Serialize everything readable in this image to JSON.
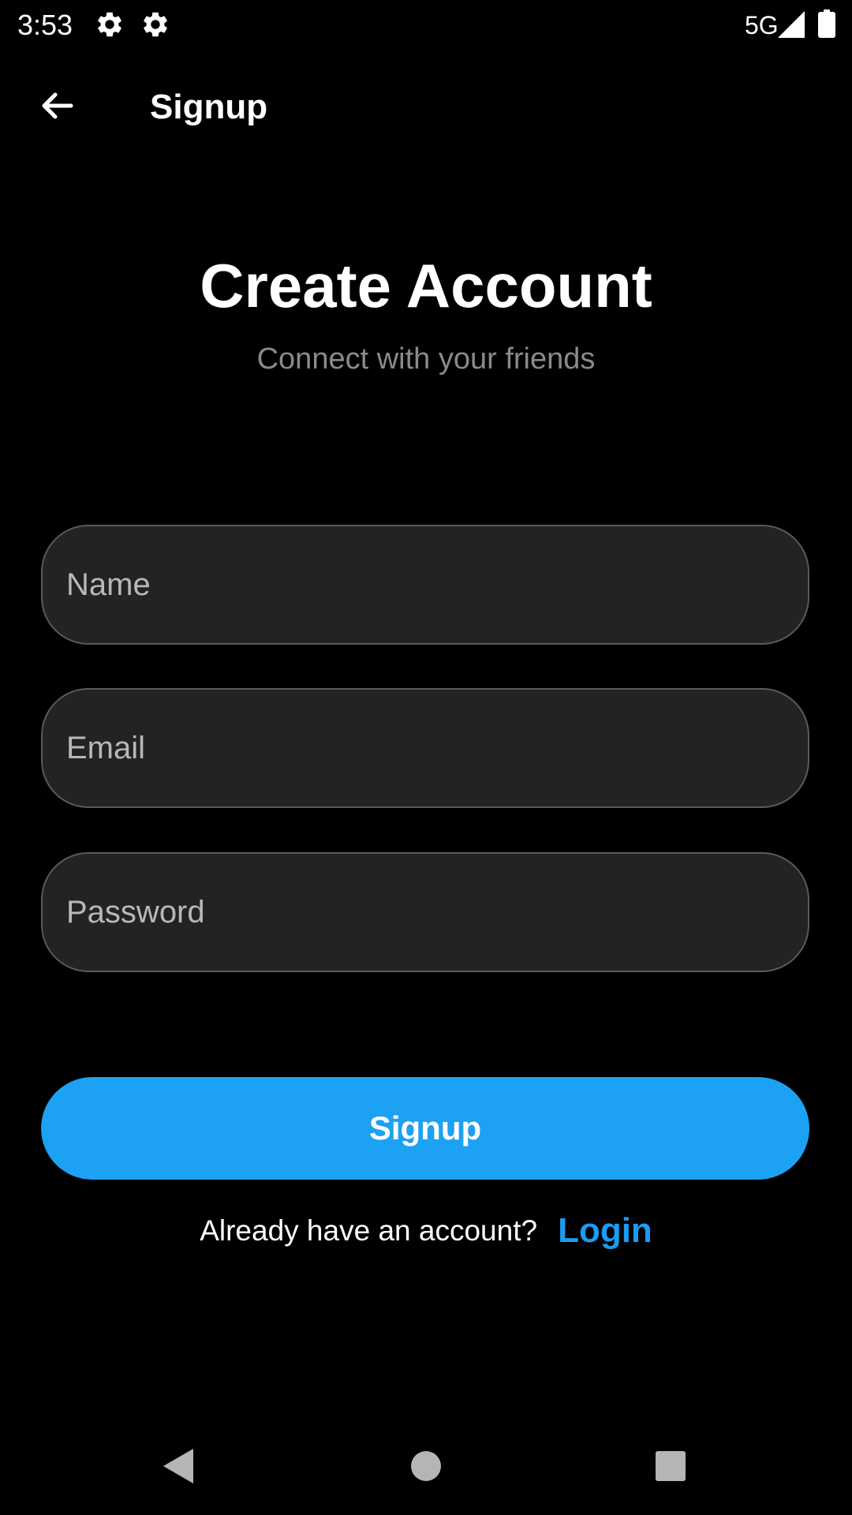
{
  "status_bar": {
    "time": "3:53",
    "network": "5G",
    "icons": [
      "gear-icon",
      "gear-icon",
      "signal-icon",
      "battery-icon"
    ]
  },
  "app_bar": {
    "title": "Signup",
    "back_icon": "arrow-left-icon"
  },
  "main": {
    "heading": "Create Account",
    "subheading": "Connect with your friends",
    "fields": {
      "name_placeholder": "Name",
      "email_placeholder": "Email",
      "password_placeholder": "Password"
    },
    "signup_button_label": "Signup",
    "login_prompt": "Already have an account?",
    "login_link": "Login"
  },
  "nav_bar": {
    "icons": [
      "nav-back-icon",
      "nav-home-icon",
      "nav-recents-icon"
    ]
  },
  "colors": {
    "background": "#000000",
    "field_background": "#232323",
    "field_border": "#5a5a5a",
    "accent": "#1da1f2",
    "link": "#1d9bf0",
    "subtitle": "#8a8a8a",
    "placeholder": "#b8b8b8"
  }
}
